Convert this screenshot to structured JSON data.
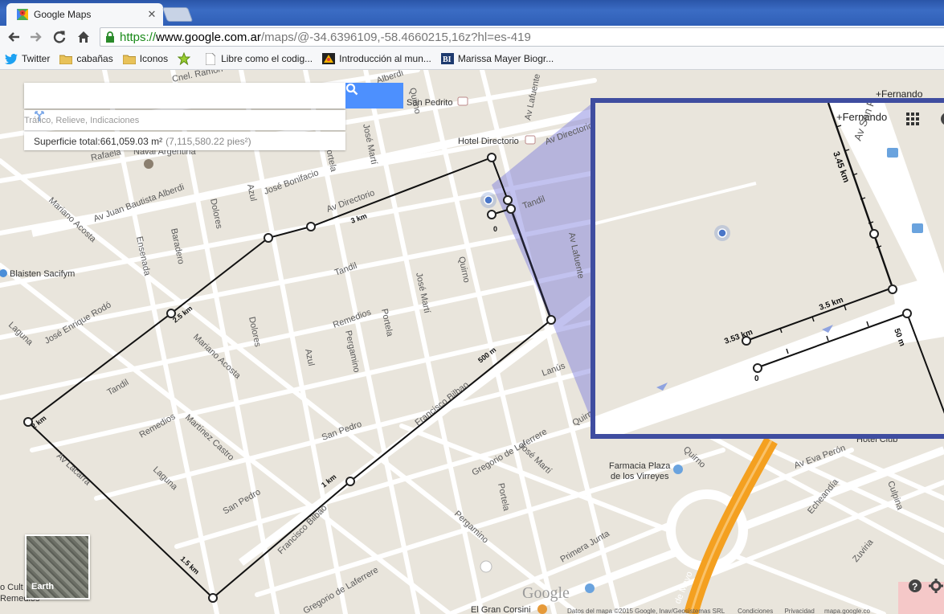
{
  "browser": {
    "tab_title": "Google Maps",
    "close_glyph": "✕",
    "url_scheme": "https://",
    "url_host": "www.google.com.ar",
    "url_path": "/maps/@-34.6396109,-58.4660215,16z?hl=es-419",
    "bookmarks": [
      {
        "label": "Twitter",
        "icon": "twitter-icon"
      },
      {
        "label": "cabañas",
        "icon": "folder-icon"
      },
      {
        "label": "Iconos",
        "icon": "folder-icon"
      },
      {
        "label": "",
        "icon": "star-icon"
      },
      {
        "label": "Libre como el codig...",
        "icon": "page-icon"
      },
      {
        "label": "Introducción al mun...",
        "icon": "image-icon"
      },
      {
        "label": "Marissa Mayer Biogr...",
        "icon": "bi-icon"
      }
    ]
  },
  "search": {
    "value": "",
    "options_text": "Tráfico, Relieve, Indicaciones"
  },
  "measure": {
    "label": "Superficie total: ",
    "area_m2": "661,059.03 m²",
    "area_ft2": "(7,115,580.22 pies²)"
  },
  "layers": {
    "label": "Earth"
  },
  "zoom_panel": {
    "user": "+Fernando",
    "street": "Av San Pedrito",
    "distances": [
      "3.45 km",
      "3.5 km",
      "3.53 km",
      "50 m",
      "0"
    ]
  },
  "footer": {
    "credits": "Datos del mapa ©2015 Google, Inav/Geosistemas SRL",
    "terms": "Condiciones",
    "privacy": "Privacidad",
    "scale": "mapa.google.co"
  },
  "map_top_right": {
    "user": "+Fernando"
  },
  "streets": {
    "cnel_ramon": "Cnel. Ramón",
    "alberdi": "Alberdi",
    "san_pedrito": "San Pedrito",
    "av_lafuente": "Av Lafuente",
    "hotel": "Hotel Directorio",
    "av_directorio": "Av Directorio",
    "rafaela": "Rafaela",
    "naval": "Naval Argentina",
    "jbalberdi": "Av Juan Bautista Alberdi",
    "bonifacio": "José Bonifacio",
    "tandil": "Tandil",
    "quirno": "Quirno",
    "jmarti": "José Martí",
    "portela": "Portela",
    "mariano": "Mariano Acosta",
    "ensenada": "Ensenada",
    "baradero": "Baradero",
    "dolores": "Dolores",
    "azul": "Azul",
    "blaisten": "Blaisten Sacifym",
    "remedios": "Remedios",
    "pergamino": "Pergamino",
    "rodo": "José Enrique Rodó",
    "laguna": "Laguna",
    "bilbao": "Francisco Bilbao",
    "lanus": "Lanús",
    "lacarra": "Av Lacarra",
    "castro": "Martínez Castro",
    "san_pedro": "San Pedro",
    "laferrere": "Gregorio de Laferrere",
    "farmacia": "Farmacia Plaza de los Virreyes",
    "eva_peron": "Av Eva Perón",
    "echeandia": "Echeandía",
    "culpina": "Culpina",
    "zuviria": "Zuviria",
    "primera_junta": "Primera Junta",
    "de_mayo": "de Mayo",
    "corsini": "El Gran Corsini",
    "hotel_club": "Hotel Club",
    "cult": "o Cult",
    "cult2": "Remedios",
    "google": "Google"
  },
  "route_distances": [
    "3 km",
    "2.5 km",
    "2 km",
    "1.5 km",
    "1 km",
    "500 m",
    "0"
  ]
}
